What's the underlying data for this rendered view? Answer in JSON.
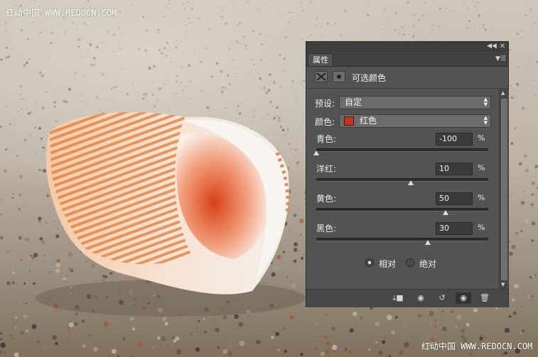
{
  "watermark_top": "红动中国 WWW.REDOCN.COM",
  "watermark_bottom": "红动中国 WWW.REDOCN.COM",
  "panel": {
    "tab_label": "属性",
    "title": "可选颜色",
    "preset_label": "预设:",
    "preset_value": "自定",
    "color_label": "颜色:",
    "color_value": "红色",
    "color_swatch": "#c5321a",
    "sliders": [
      {
        "label": "青色:",
        "value": "-100",
        "unit": "%",
        "level": -100
      },
      {
        "label": "洋红:",
        "value": "10",
        "unit": "%",
        "level": 10
      },
      {
        "label": "黄色:",
        "value": "50",
        "unit": "%",
        "level": 50
      },
      {
        "label": "黑色:",
        "value": "30",
        "unit": "%",
        "level": 30
      }
    ],
    "method_relative": "相对",
    "method_absolute": "绝对",
    "method_selected": "relative",
    "footer_icons": [
      "clip-to-layer-icon",
      "view-previous-icon",
      "reset-icon",
      "visibility-icon",
      "trash-icon"
    ]
  }
}
